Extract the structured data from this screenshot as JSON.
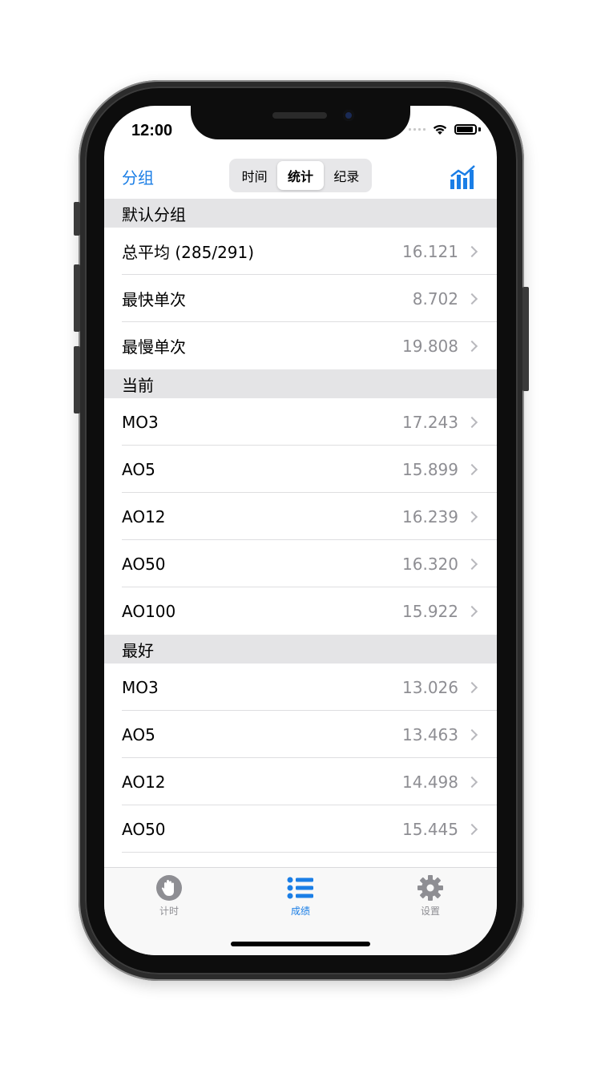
{
  "status": {
    "time": "12:00"
  },
  "nav": {
    "left_label": "分组",
    "segments": [
      "时间",
      "统计",
      "纪录"
    ],
    "active_segment": "统计"
  },
  "sections": [
    {
      "title": "默认分组",
      "rows": [
        {
          "label": "总平均 (285/291)",
          "value": "16.121"
        },
        {
          "label": "最快单次",
          "value": "8.702"
        },
        {
          "label": "最慢单次",
          "value": "19.808"
        }
      ]
    },
    {
      "title": "当前",
      "rows": [
        {
          "label": "MO3",
          "value": "17.243"
        },
        {
          "label": "AO5",
          "value": "15.899"
        },
        {
          "label": "AO12",
          "value": "16.239"
        },
        {
          "label": "AO50",
          "value": "16.320"
        },
        {
          "label": "AO100",
          "value": "15.922"
        }
      ]
    },
    {
      "title": "最好",
      "rows": [
        {
          "label": "MO3",
          "value": "13.026"
        },
        {
          "label": "AO5",
          "value": "13.463"
        },
        {
          "label": "AO12",
          "value": "14.498"
        },
        {
          "label": "AO50",
          "value": "15.445"
        }
      ]
    }
  ],
  "tabbar": {
    "tabs": [
      {
        "label": "计时",
        "icon": "hand-timer-icon",
        "active": false
      },
      {
        "label": "成绩",
        "icon": "list-icon",
        "active": true
      },
      {
        "label": "设置",
        "icon": "gear-icon",
        "active": false
      }
    ]
  },
  "colors": {
    "accent": "#1a7ee6",
    "secondary_text": "#8e8e93",
    "section_background": "#e4e4e6",
    "tab_inactive": "#8e8e93"
  }
}
